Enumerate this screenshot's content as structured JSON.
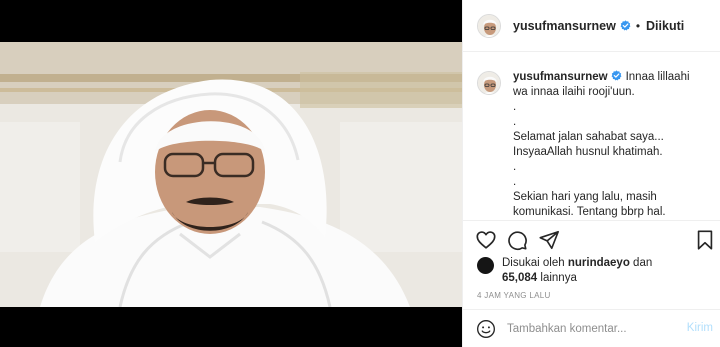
{
  "post": {
    "username": "yusufmansurnew",
    "follow_status": "Diikuti",
    "separator": "•",
    "caption_lines": [
      "Innaa lillaahi",
      "wa innaa ilaihi rooji'uun.",
      ".",
      ".",
      "Selamat jalan sahabat saya...",
      "InsyaaAllah husnul khatimah.",
      ".",
      ".",
      "Sekian hari yang lalu, masih",
      "komunikasi. Tentang bbrp hal."
    ],
    "likes": {
      "prefix": "Disukai oleh",
      "user": "nurindaeyo",
      "conj": "dan",
      "count": "65,084",
      "suffix": "lainnya"
    },
    "timestamp": "4 JAM YANG LALU"
  },
  "comment": {
    "placeholder": "Tambahkan komentar...",
    "post_label": "Kirim"
  },
  "icons": {
    "verified": "verified-badge-icon",
    "like": "heart-icon",
    "comment": "comment-icon",
    "share": "share-icon",
    "save": "bookmark-icon",
    "emoji": "emoji-icon"
  },
  "colors": {
    "verified_blue": "#3897f0",
    "post_disabled": "#b2dffc",
    "muted": "#8e8e8e"
  }
}
